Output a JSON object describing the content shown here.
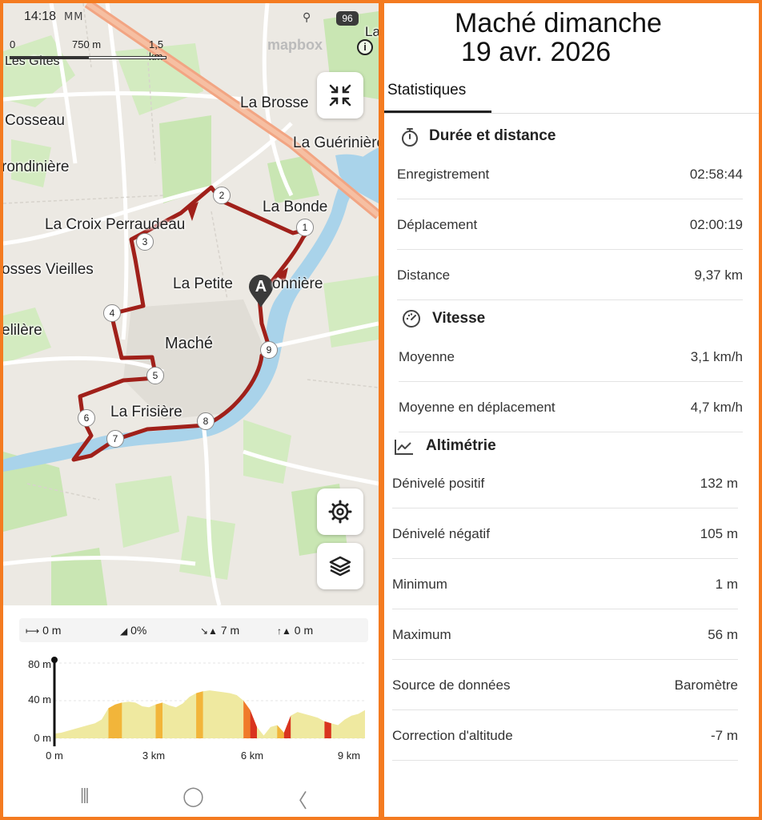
{
  "status_bar": {
    "time": "14:18",
    "notif": "ⅯⅯ",
    "wifi": "⚲",
    "battery": "96"
  },
  "map": {
    "scale_labels": [
      "0",
      "750 m",
      "1,5 km"
    ],
    "attribution": "mapbox",
    "info_label": "i",
    "start_marker": "A",
    "waypoints": [
      "1",
      "2",
      "3",
      "4",
      "5",
      "6",
      "7",
      "8",
      "9"
    ],
    "places": [
      "Les Gîtes",
      "La Brosse",
      "Cosseau",
      "La Guérinière",
      "rondinière",
      "La Bonde",
      "La Croix Perraudeau",
      "osses Vieilles",
      "La Petite",
      "onnière",
      "elilère",
      "Maché",
      "La Frisière",
      "La"
    ]
  },
  "elevation": {
    "stats": [
      {
        "icon": "distance-icon",
        "glyph": "⟼",
        "value": "0 m"
      },
      {
        "icon": "slope-icon",
        "glyph": "◢",
        "value": "0%"
      },
      {
        "icon": "descent-icon",
        "glyph": "↘▲",
        "value": "7 m"
      },
      {
        "icon": "ascent-icon",
        "glyph": "↑▲",
        "value": "0 m"
      }
    ],
    "y_ticks": [
      "80 m",
      "40 m",
      "0 m"
    ],
    "x_ticks": [
      "0 m",
      "3 km",
      "6 km",
      "9 km"
    ],
    "profile_m": [
      5,
      6,
      8,
      10,
      12,
      14,
      16,
      20,
      32,
      36,
      38,
      39,
      38,
      34,
      33,
      36,
      38,
      35,
      33,
      37,
      44,
      48,
      50,
      51,
      50,
      49,
      48,
      46,
      40,
      30,
      12,
      3,
      12,
      14,
      6,
      24,
      28,
      26,
      24,
      22,
      18,
      16,
      14,
      20,
      24,
      26,
      30
    ],
    "total_km": 9.37,
    "y_max_m": 80
  },
  "nav": {
    "recents": "|||",
    "home": "◯",
    "back": "〈"
  },
  "colors": {
    "route": "#a0201a",
    "accent_frame": "#f47b20",
    "water": "#a9d3ea",
    "park": "#c9e6b3",
    "road": "#ffffff",
    "highway": "#f2a583"
  },
  "header": {
    "title_line1": "Maché dimanche",
    "title_line2": "19 avr. 2026",
    "tab": "Statistiques"
  },
  "sections": {
    "duration": {
      "title": "Durée et distance",
      "rows": [
        {
          "label": "Enregistrement",
          "value": "02:58:44"
        },
        {
          "label": "Déplacement",
          "value": "02:00:19"
        },
        {
          "label": "Distance",
          "value": "9,37 km"
        }
      ]
    },
    "speed": {
      "title": "Vitesse",
      "rows": [
        {
          "label": "Moyenne",
          "value": "3,1 km/h"
        },
        {
          "label": "Moyenne en déplacement",
          "value": "4,7 km/h"
        }
      ]
    },
    "altimetry": {
      "title": "Altimétrie",
      "rows": [
        {
          "label": "Dénivelé positif",
          "value": "132 m"
        },
        {
          "label": "Dénivelé négatif",
          "value": "105 m"
        },
        {
          "label": "Minimum",
          "value": "1 m"
        },
        {
          "label": "Maximum",
          "value": "56 m"
        },
        {
          "label": "Source de données",
          "value": "Baromètre"
        },
        {
          "label": "Correction d'altitude",
          "value": "-7 m"
        }
      ]
    }
  }
}
